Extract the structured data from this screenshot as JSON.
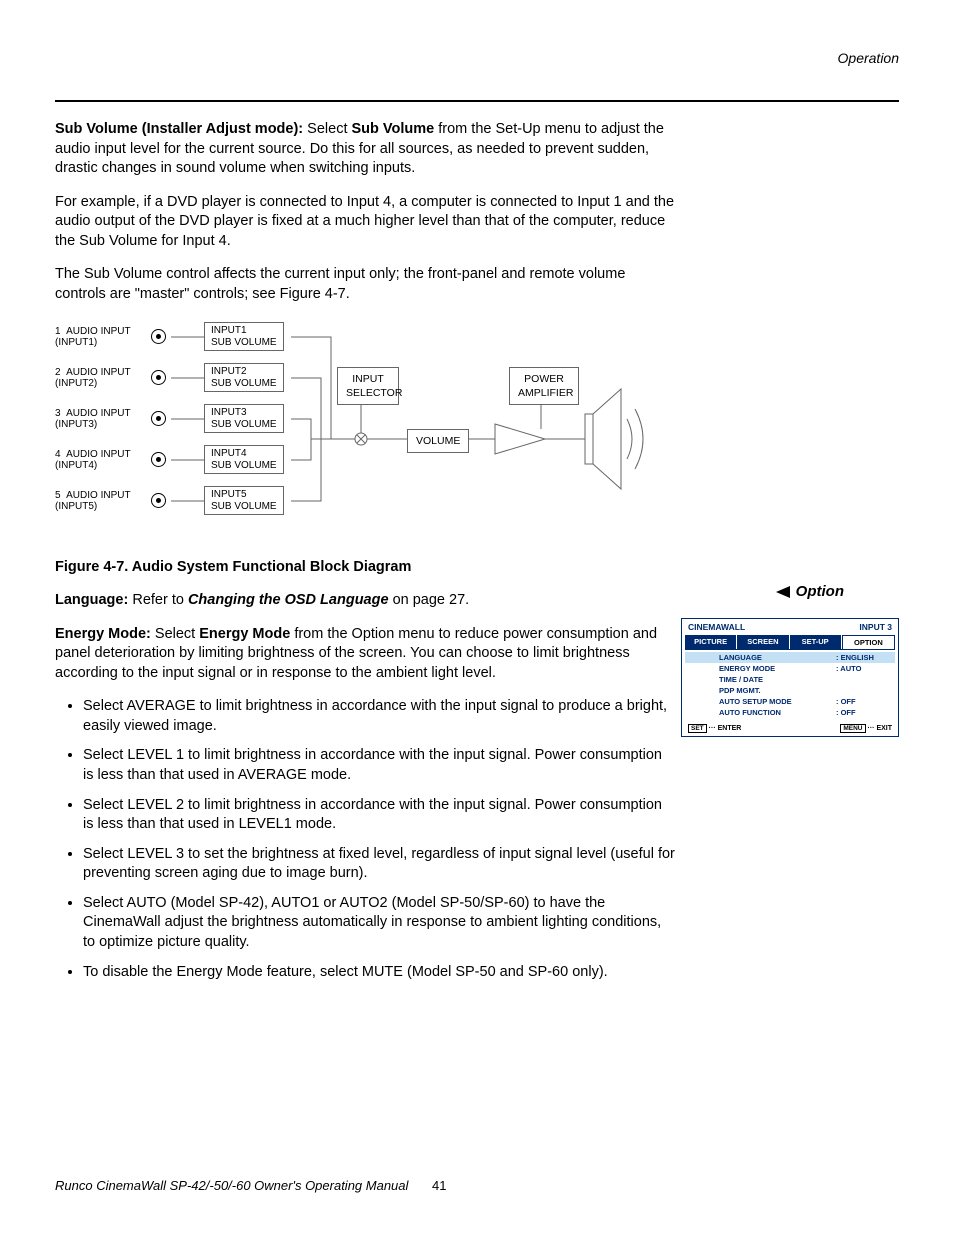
{
  "header": {
    "section": "Operation"
  },
  "body": {
    "para1_b1": "Sub Volume (Installer Adjust mode): ",
    "para1_t1": "Select ",
    "para1_b2": "Sub Volume",
    "para1_t2": " from the Set-Up menu to adjust the audio input level for the current source. Do this for all sources, as needed to prevent sudden, drastic changes in sound volume when switching inputs.",
    "para2": "For example, if a DVD player is connected to Input 4, a computer is connected to Input 1 and the audio output of the DVD player is fixed at a much higher level than that of the computer, reduce the Sub Volume for Input 4.",
    "para3": "The Sub Volume control affects the current input only; the front-panel and remote volume controls are \"master\" controls; see Figure 4-7.",
    "fig_caption": "Figure 4-7. Audio System Functional Block Diagram",
    "lang_b": "Language: ",
    "lang_t1": "Refer to ",
    "lang_ib": "Changing the OSD Language",
    "lang_t2": " on page 27.",
    "energy_b": "Energy Mode: ",
    "energy_t1": "Select ",
    "energy_b2": "Energy Mode",
    "energy_t2": " from the Option menu to reduce power consumption and panel deterioration by limiting brightness of the screen. You can choose to limit brightness according to the input signal or in response to the ambient light level.",
    "bullets": [
      "Select AVERAGE to limit brightness in accordance with the input signal to produce a bright, easily viewed image.",
      "Select LEVEL 1 to limit brightness in accordance with the input signal. Power consumption is less than that used in AVERAGE mode.",
      "Select LEVEL 2 to limit brightness in accordance with the input signal. Power consumption is less than that used in LEVEL1 mode.",
      "Select LEVEL 3 to set the brightness at fixed level, regardless of input signal level (useful for preventing screen aging due to image burn).",
      "Select AUTO (Model SP-42), AUTO1 or AUTO2 (Model SP-50/SP-60) to have the CinemaWall adjust the brightness automatically in response to ambient lighting conditions, to optimize picture quality.",
      "To disable the Energy Mode feature, select MUTE (Model SP-50 and SP-60 only)."
    ]
  },
  "diagram": {
    "inputs": [
      {
        "n": "1",
        "l1": "AUDIO INPUT",
        "l2": "(INPUT1)",
        "s1": "INPUT1",
        "s2": "SUB VOLUME"
      },
      {
        "n": "2",
        "l1": "AUDIO INPUT",
        "l2": "(INPUT2)",
        "s1": "INPUT2",
        "s2": "SUB VOLUME"
      },
      {
        "n": "3",
        "l1": "AUDIO INPUT",
        "l2": "(INPUT3)",
        "s1": "INPUT3",
        "s2": "SUB VOLUME"
      },
      {
        "n": "4",
        "l1": "AUDIO INPUT",
        "l2": "(INPUT4)",
        "s1": "INPUT4",
        "s2": "SUB VOLUME"
      },
      {
        "n": "5",
        "l1": "AUDIO INPUT",
        "l2": "(INPUT5)",
        "s1": "INPUT5",
        "s2": "SUB VOLUME"
      }
    ],
    "selector": "INPUT SELECTOR",
    "volume": "VOLUME",
    "amp": "POWER AMPLIFIER"
  },
  "sidebar": {
    "option": "Option"
  },
  "osd": {
    "title": "CINEMAWALL",
    "input": "INPUT 3",
    "tabs": [
      "PICTURE",
      "SCREEN",
      "SET-UP",
      "OPTION"
    ],
    "rows": [
      {
        "k": "LANGUAGE",
        "v": ": ENGLISH",
        "hi": true
      },
      {
        "k": "ENERGY MODE",
        "v": ": AUTO"
      },
      {
        "k": "TIME / DATE",
        "v": ""
      },
      {
        "k": "PDP MGMT.",
        "v": ""
      },
      {
        "k": "AUTO SETUP MODE",
        "v": ": OFF"
      },
      {
        "k": "AUTO FUNCTION",
        "v": ": OFF"
      }
    ],
    "foot_l_tag": "SET",
    "foot_l": "··· ENTER",
    "foot_r_tag": "MENU",
    "foot_r": "··· EXIT"
  },
  "footer": {
    "title": "Runco CinemaWall SP-42/-50/-60 Owner's Operating Manual",
    "page": "41"
  }
}
